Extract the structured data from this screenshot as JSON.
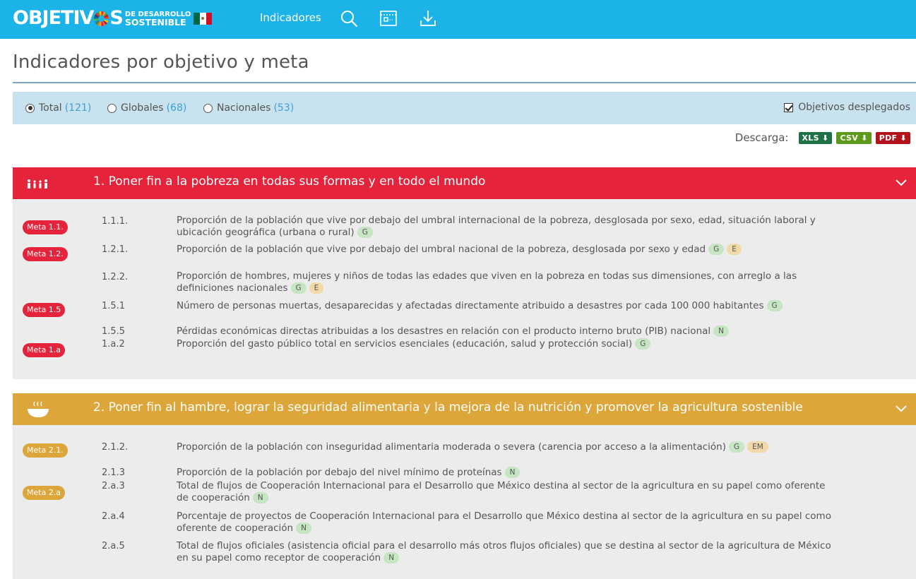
{
  "header": {
    "logo_main_left": "OBJETIV",
    "logo_main_right": "S",
    "logo_sub_top": "DE DESARROLLO",
    "logo_sub_bottom": "SOSTENIBLE",
    "nav_label": "Indicadores",
    "icons": [
      "search-icon",
      "calendar-icon",
      "download-icon"
    ]
  },
  "page": {
    "title": "Indicadores por objetivo y meta"
  },
  "filters": {
    "total_label": "Total",
    "total_count": "(121)",
    "globales_label": "Globales",
    "globales_count": "(68)",
    "nacionales_label": "Nacionales",
    "nacionales_count": "(53)",
    "selected": "Total",
    "expanded_label": "Objetivos desplegados",
    "expanded_checked": true
  },
  "download": {
    "label": "Descarga:",
    "xls": "XLS ⬇",
    "csv": "CSV ⬇",
    "pdf": "PDF ⬇"
  },
  "colors": {
    "topbar": "#1cb3e8",
    "goal1": "#e5243b",
    "goal2": "#dda63a",
    "xls": "#1e7145",
    "csv": "#5b9a1a",
    "pdf": "#b3121b"
  },
  "goals": [
    {
      "title": "1. Poner fin a la pobreza en todas sus formas y en todo el mundo",
      "icon": "family-icon",
      "metas": [
        "Meta 1.1.",
        "Meta 1.2.",
        "Meta 1.5",
        "Meta 1.a"
      ],
      "indicators": [
        {
          "code": "1.1.1.",
          "text": "Proporción de la población que vive por debajo del umbral internacional de la pobreza, desglosada por sexo, edad, situación laboral y",
          "text2": "ubicación geográfica (urbana o rural)",
          "tags": [
            "G"
          ]
        },
        {
          "code": "1.2.1.",
          "text": "Proporción de la población que vive por debajo del umbral nacional de la pobreza, desglosada por sexo y edad",
          "tags": [
            "G",
            "E"
          ]
        },
        {
          "code": "1.2.2.",
          "text": "Proporción de hombres, mujeres y niños de todas las edades que viven en la pobreza en todas sus dimensiones, con arreglo a las",
          "text2": "definiciones nacionales",
          "tags": [
            "G",
            "E"
          ]
        },
        {
          "code": "1.5.1",
          "text": "Número de personas muertas, desaparecidas y afectadas directamente atribuido a desastres por cada 100 000 habitantes",
          "tags": [
            "G"
          ]
        },
        {
          "code": "1.5.5",
          "text": "Pérdidas económicas directas atribuidas a los desastres en relación con el producto interno bruto (PIB) nacional",
          "tags": [
            "N"
          ]
        },
        {
          "code": "1.a.2",
          "text": "Proporción del gasto público total en servicios esenciales (educación, salud y protección social)",
          "tags": [
            "G"
          ]
        }
      ]
    },
    {
      "title": "2. Poner fin al hambre, lograr la seguridad alimentaria y la mejora de la nutrición y promover la agricultura sostenible",
      "icon": "bowl-icon",
      "metas": [
        "Meta 2.1.",
        "Meta 2.a"
      ],
      "indicators": [
        {
          "code": "2.1.2.",
          "text": "Proporción de la población con inseguridad alimentaria moderada o severa (carencia por acceso a la alimentación)",
          "tags": [
            "G",
            "EM"
          ]
        },
        {
          "code": "2.1.3",
          "text": "Proporción de la población por debajo del nivel mínimo de proteínas",
          "tags": [
            "N"
          ]
        },
        {
          "code": "2.a.3",
          "text": "Total de flujos de Cooperación Internacional para el Desarrollo que México destina al sector de la agricultura en su papel como oferente",
          "text2": "de cooperación",
          "tags": [
            "N"
          ]
        },
        {
          "code": "2.a.4",
          "text": "Porcentaje de proyectos de Cooperación Internacional para el Desarrollo que México destina al sector de la agricultura en su papel como",
          "text2": "oferente de cooperación",
          "tags": [
            "N"
          ]
        },
        {
          "code": "2.a.5",
          "text": "Total de flujos oficiales (asistencia oficial para el desarrollo más otros flujos oficiales) que se destina al sector de la agricultura de México",
          "text2": "en su papel como receptor de cooperación",
          "tags": [
            "N"
          ]
        }
      ]
    }
  ]
}
